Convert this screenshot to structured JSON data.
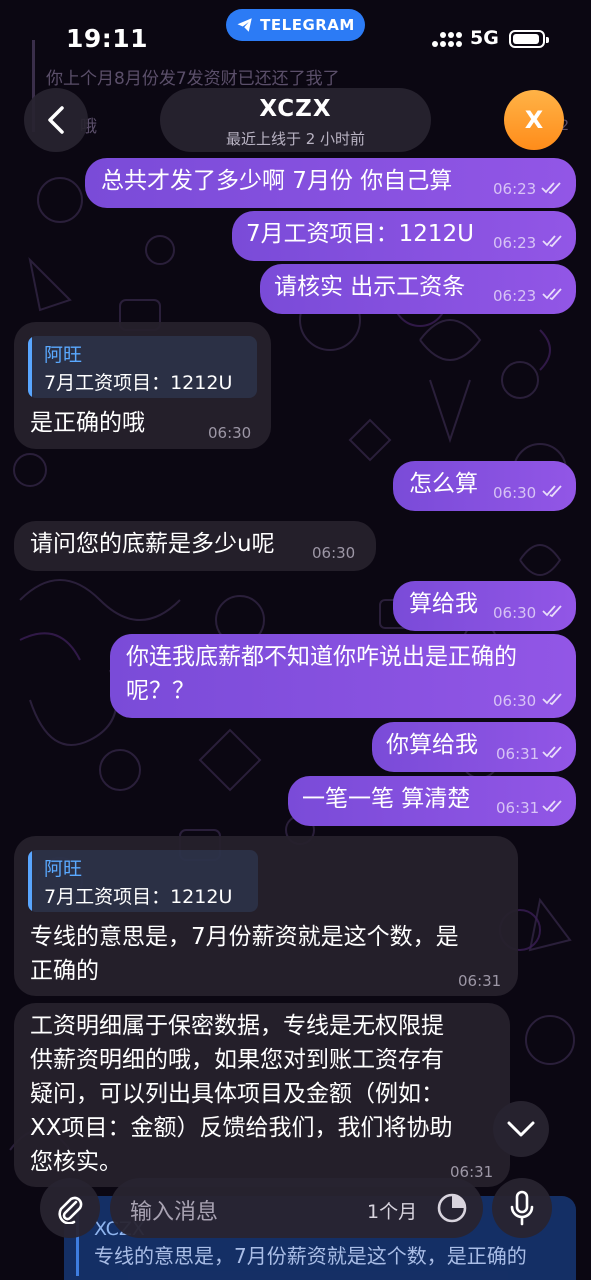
{
  "status_bar": {
    "time": "19:11",
    "app_pill": "TELEGRAM",
    "network": "5G"
  },
  "background_preview": {
    "line1": "你上个月8月份发7发资财已还还了我了",
    "line2": "哦",
    "time": "06:2"
  },
  "header": {
    "name": "XCZX",
    "subtitle": "最近上线于 2 小时前",
    "avatar_letter": "X"
  },
  "messages": [
    {
      "dir": "out",
      "text": "总共才发了多少啊 7月份 你自己算",
      "time": "06:23"
    },
    {
      "dir": "out",
      "text": "7月工资项目：1212U",
      "time": "06:23"
    },
    {
      "dir": "out",
      "text": "请核实 出示工资条",
      "time": "06:23"
    },
    {
      "dir": "in",
      "reply_name": "阿旺",
      "reply_text": "7月工资项目：1212U",
      "text": "是正确的哦",
      "time": "06:30"
    },
    {
      "dir": "out",
      "text": "怎么算",
      "time": "06:30"
    },
    {
      "dir": "in",
      "text": "请问您的底薪是多少u呢",
      "time": "06:30"
    },
    {
      "dir": "out",
      "text": "算给我",
      "time": "06:30"
    },
    {
      "dir": "out",
      "lines": [
        "你连我底薪都不知道你咋说出是正确的",
        "呢？？"
      ],
      "time": "06:30"
    },
    {
      "dir": "out",
      "text": "你算给我",
      "time": "06:31"
    },
    {
      "dir": "out",
      "text": "一笔一笔 算清楚",
      "time": "06:31"
    },
    {
      "dir": "in",
      "reply_name": "阿旺",
      "reply_text": "7月工资项目：1212U",
      "lines": [
        "专线的意思是，7月份薪资就是这个数，是",
        "正确的"
      ],
      "time": "06:31"
    },
    {
      "dir": "in",
      "lines": [
        "工资明细属于保密数据，专线是无权限提",
        "供薪资明细的哦，如果您对到账工资存有",
        "疑问，可以列出具体项目及金额（例如：",
        "XX项目：金额）反馈给我们，我们将协助",
        "您核实。"
      ],
      "time": "06:31"
    }
  ],
  "pinned_preview": {
    "name": "XCZX",
    "text": "专线的意思是，7月份薪资就是这个数，是正确的"
  },
  "input_bar": {
    "placeholder": "输入消息",
    "timer": "1个月"
  },
  "icons": [
    "telegram-plane-icon",
    "signal-icon",
    "battery-icon",
    "back-chevron-icon",
    "attach-icon",
    "clock-icon",
    "mic-icon",
    "chevron-down-icon",
    "double-check-icon"
  ],
  "colors": {
    "outgoing": "#8450e0",
    "incoming": "#26212c",
    "accent_blue": "#2c7bf5",
    "avatar": "#ff9a2e",
    "reply_name": "#5aa9ff"
  }
}
